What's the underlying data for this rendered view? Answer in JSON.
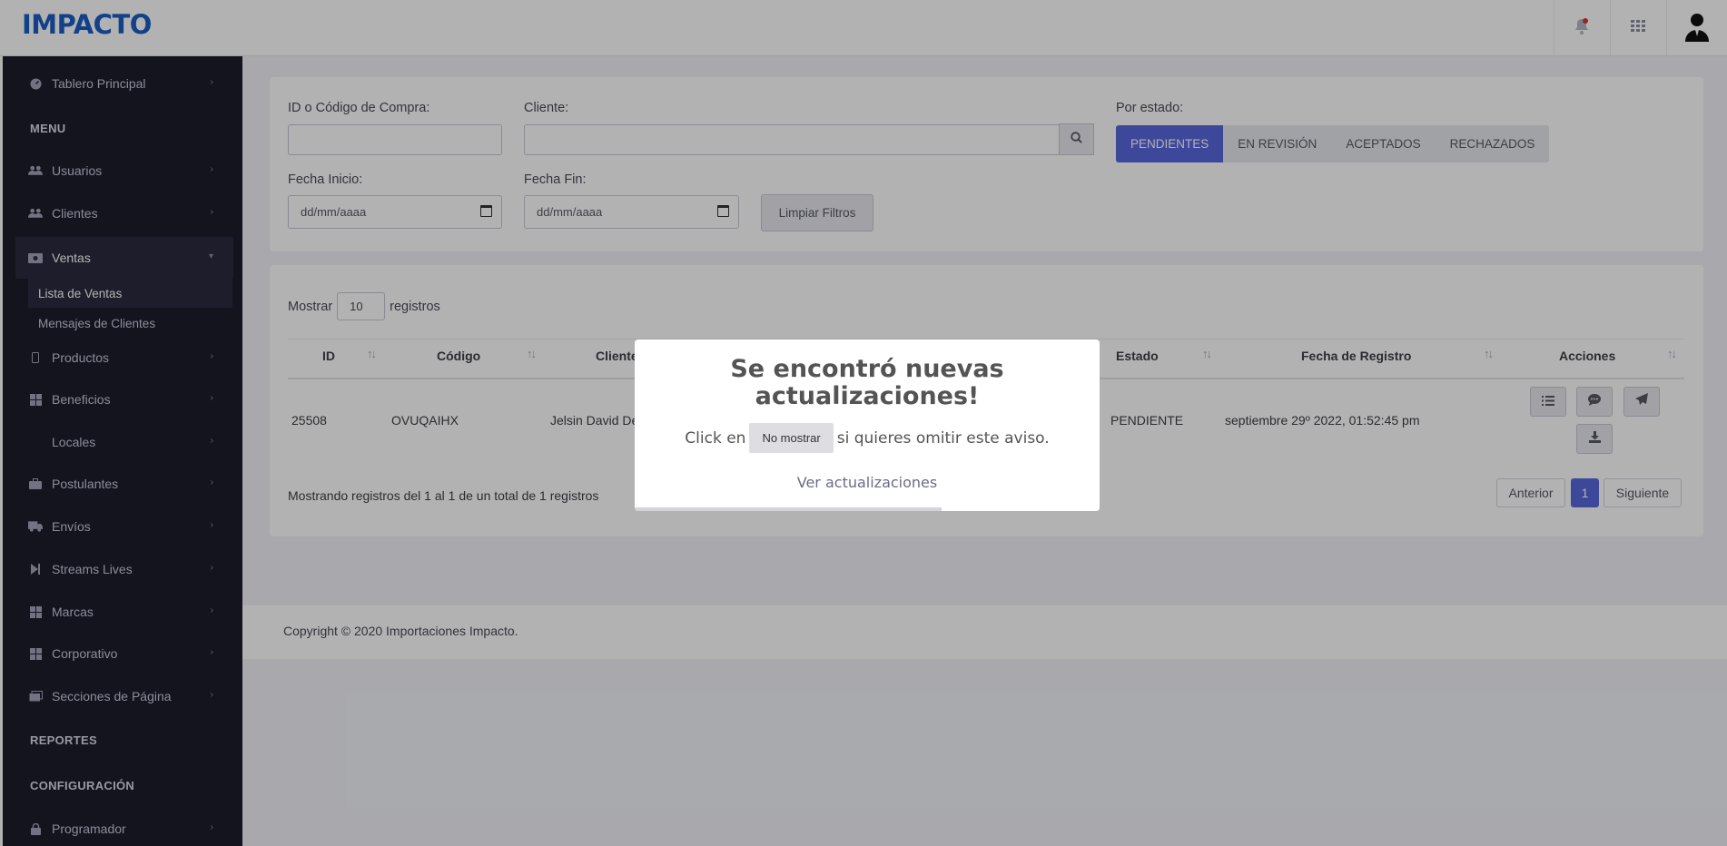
{
  "header": {
    "logo": "IMPACTO"
  },
  "sidebar": {
    "dashboard": "Tablero Principal",
    "section_menu": "MENU",
    "items": [
      {
        "label": "Usuarios"
      },
      {
        "label": "Clientes"
      },
      {
        "label": "Ventas"
      },
      {
        "label": "Productos"
      },
      {
        "label": "Beneficios"
      },
      {
        "label": "Locales"
      },
      {
        "label": "Postulantes"
      },
      {
        "label": "Envíos"
      },
      {
        "label": "Streams Lives"
      },
      {
        "label": "Marcas"
      },
      {
        "label": "Corporativo"
      },
      {
        "label": "Secciones de Página"
      }
    ],
    "sub_items": [
      {
        "label": "Lista de Ventas"
      },
      {
        "label": "Mensajes de Clientes"
      }
    ],
    "section_reports": "REPORTES",
    "section_config": "CONFIGURACIÓN",
    "programmer": "Programador"
  },
  "filters": {
    "id_label": "ID o Código de Compra:",
    "client_label": "Cliente:",
    "state_label": "Por estado:",
    "start_label": "Fecha Inicio:",
    "end_label": "Fecha Fin:",
    "start_placeholder": "dd/mm/aaaa",
    "end_placeholder": "dd/mm/aaaa",
    "clear_button": "Limpiar Filtros",
    "states": [
      "PENDIENTES",
      "EN REVISIÓN",
      "ACEPTADOS",
      "RECHAZADOS"
    ],
    "active_state": "PENDIENTES"
  },
  "table": {
    "show_label": "Mostrar",
    "show_value": "10",
    "records_label": "registros",
    "columns": [
      "ID",
      "Código",
      "Cliente",
      "Estado",
      "Fecha de Registro",
      "Acciones"
    ],
    "rows": [
      {
        "id": "25508",
        "code": "OVUQAIHX",
        "client": "Jelsin David De",
        "state": "PENDIENTE",
        "date": "septiembre 29º 2022, 01:52:45 pm"
      }
    ],
    "summary": "Mostrando registros del 1 al 1 de un total de 1 registros",
    "pagination": {
      "prev": "Anterior",
      "current": "1",
      "next": "Siguiente"
    }
  },
  "footer": {
    "copyright": "Copyright © 2020 Importaciones Impacto."
  },
  "modal": {
    "title_line1": "Se encontró nuevas",
    "title_line2": "actualizaciones!",
    "text_before": "Click en",
    "button": "No mostrar",
    "text_after": "si quieres omitir este aviso.",
    "link": "Ver actualizaciones",
    "progress": 0.66
  },
  "colors": {
    "accent": "#5867dd",
    "logo": "#1a5ec4",
    "sidebar_bg": "#1e1e2d"
  }
}
